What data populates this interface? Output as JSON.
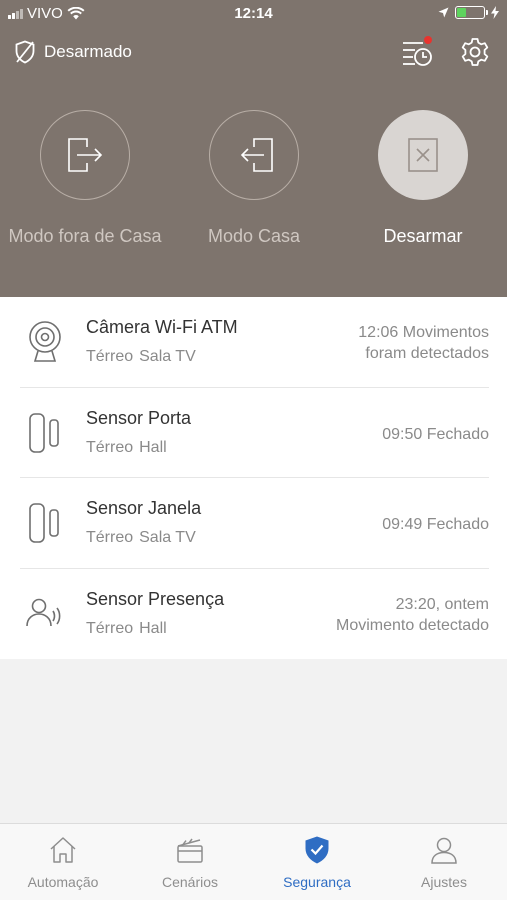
{
  "status_bar": {
    "carrier": "VIVO",
    "time": "12:14"
  },
  "header": {
    "state_label": "Desarmado"
  },
  "modes": [
    {
      "label": "Modo fora de Casa",
      "active": false
    },
    {
      "label": "Modo Casa",
      "active": false
    },
    {
      "label": "Desarmar",
      "active": true
    }
  ],
  "devices": [
    {
      "name": "Câmera Wi-Fi ATM",
      "floor": "Térreo",
      "room": "Sala TV",
      "status_line1": "12:06 Movimentos",
      "status_line2": "foram detectados",
      "icon": "camera-icon"
    },
    {
      "name": "Sensor Porta",
      "floor": "Térreo",
      "room": "Hall",
      "status_line1": "09:50 Fechado",
      "status_line2": "",
      "icon": "door-sensor-icon"
    },
    {
      "name": "Sensor Janela",
      "floor": "Térreo",
      "room": "Sala TV",
      "status_line1": "09:49 Fechado",
      "status_line2": "",
      "icon": "window-sensor-icon"
    },
    {
      "name": "Sensor Presença",
      "floor": "Térreo",
      "room": "Hall",
      "status_line1": "23:20, ontem",
      "status_line2": "Movimento detectado",
      "icon": "presence-sensor-icon"
    }
  ],
  "tabs": [
    {
      "label": "Automação",
      "icon": "home-icon",
      "active": false
    },
    {
      "label": "Cenários",
      "icon": "clapperboard-icon",
      "active": false
    },
    {
      "label": "Segurança",
      "icon": "shield-icon",
      "active": true
    },
    {
      "label": "Ajustes",
      "icon": "user-icon",
      "active": false
    }
  ],
  "colors": {
    "header_bg": "#7e746d",
    "accent": "#2f6dc3",
    "notification": "#e8332e"
  }
}
